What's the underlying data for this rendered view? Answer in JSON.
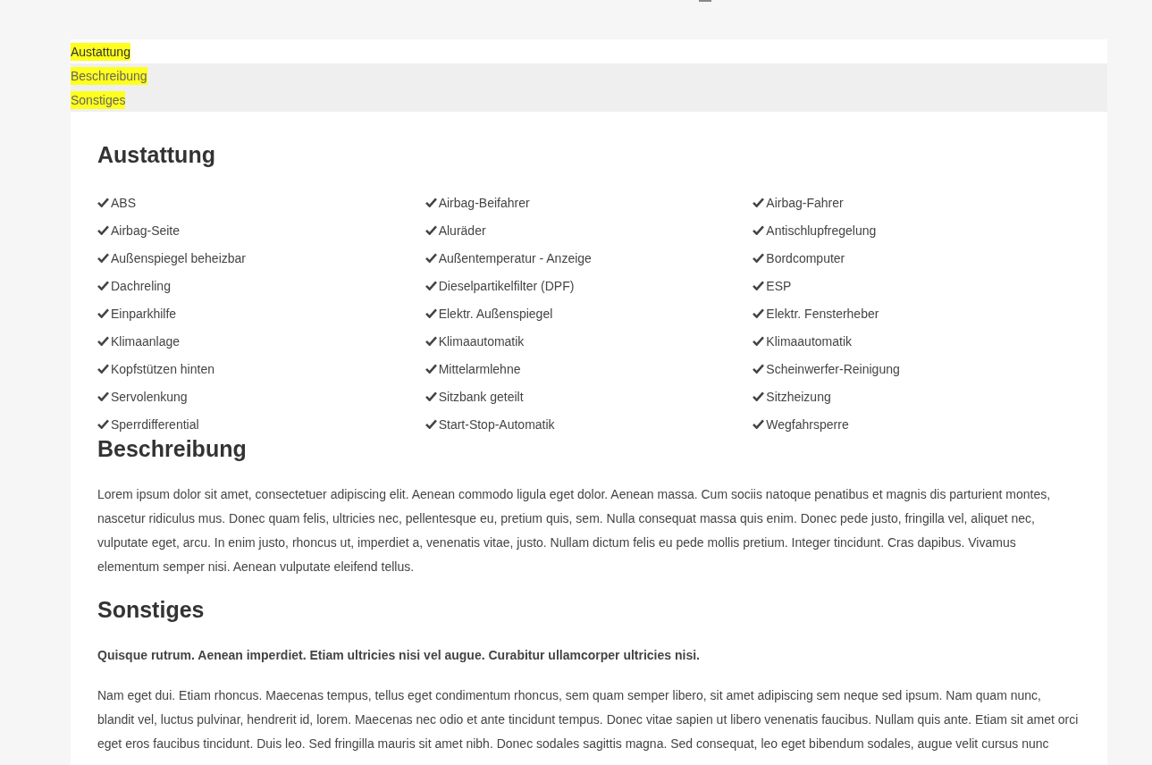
{
  "tabs": [
    {
      "label": "Austattung",
      "selected": true,
      "highlighted": true
    },
    {
      "label": "Beschreibung",
      "selected": false,
      "highlighted": true
    },
    {
      "label": "Sonstiges",
      "selected": false,
      "highlighted": true
    }
  ],
  "sections": [
    {
      "kind": "features",
      "title": "Austattung",
      "items": [
        "ABS",
        "Airbag-Beifahrer",
        "Airbag-Fahrer",
        "Airbag-Seite",
        "Aluräder",
        "Antischlupfregelung",
        "Außenspiegel beheizbar",
        "Außentemperatur - Anzeige",
        "Bordcomputer",
        "Dachreling",
        "Dieselpartikelfilter (DPF)",
        "ESP",
        "Einparkhilfe",
        "Elektr. Außenspiegel",
        "Elektr. Fensterheber",
        "Klimaanlage",
        "Klimaautomatik",
        "Klimaautomatik",
        "Kopfstützen hinten",
        "Mittelarmlehne",
        "Scheinwerfer-Reinigung",
        "Servolenkung",
        "Sitzbank geteilt",
        "Sitzheizung",
        "Sperrdifferential",
        "Start-Stop-Automatik",
        "Wegfahrsperre"
      ]
    },
    {
      "kind": "text",
      "title": "Beschreibung",
      "paragraphs": [
        "Lorem ipsum dolor sit amet, consectetuer adipiscing elit. Aenean commodo ligula eget dolor. Aenean massa. Cum sociis natoque penatibus et magnis dis parturient montes, nascetur ridiculus mus. Donec quam felis, ultricies nec, pellentesque eu, pretium quis, sem. Nulla consequat massa quis enim. Donec pede justo, fringilla vel, aliquet nec, vulputate eget, arcu. In enim justo, rhoncus ut, imperdiet a, venenatis vitae, justo. Nullam dictum felis eu pede mollis pretium. Integer tincidunt. Cras dapibus. Vivamus elementum semper nisi. Aenean vulputate eleifend tellus."
      ]
    },
    {
      "kind": "text",
      "title": "Sonstiges",
      "paragraphs": [
        "**Quisque rutrum. Aenean imperdiet. Etiam ultricies nisi vel augue. Curabitur ullamcorper ultricies nisi.**",
        "Nam eget dui. Etiam rhoncus. Maecenas tempus, tellus eget condimentum rhoncus, sem quam semper libero, sit amet adipiscing sem neque sed ipsum. Nam quam nunc, blandit vel, luctus pulvinar, hendrerit id, lorem. Maecenas nec odio et ante tincidunt tempus. Donec vitae sapien ut libero venenatis faucibus. Nullam quis ante. Etiam sit amet orci eget eros faucibus tincidunt. Duis leo. Sed fringilla mauris sit amet nibh. Donec sodales sagittis magna. Sed consequat, leo eget bibendum sodales, augue velit cursus nunc"
      ]
    }
  ]
}
